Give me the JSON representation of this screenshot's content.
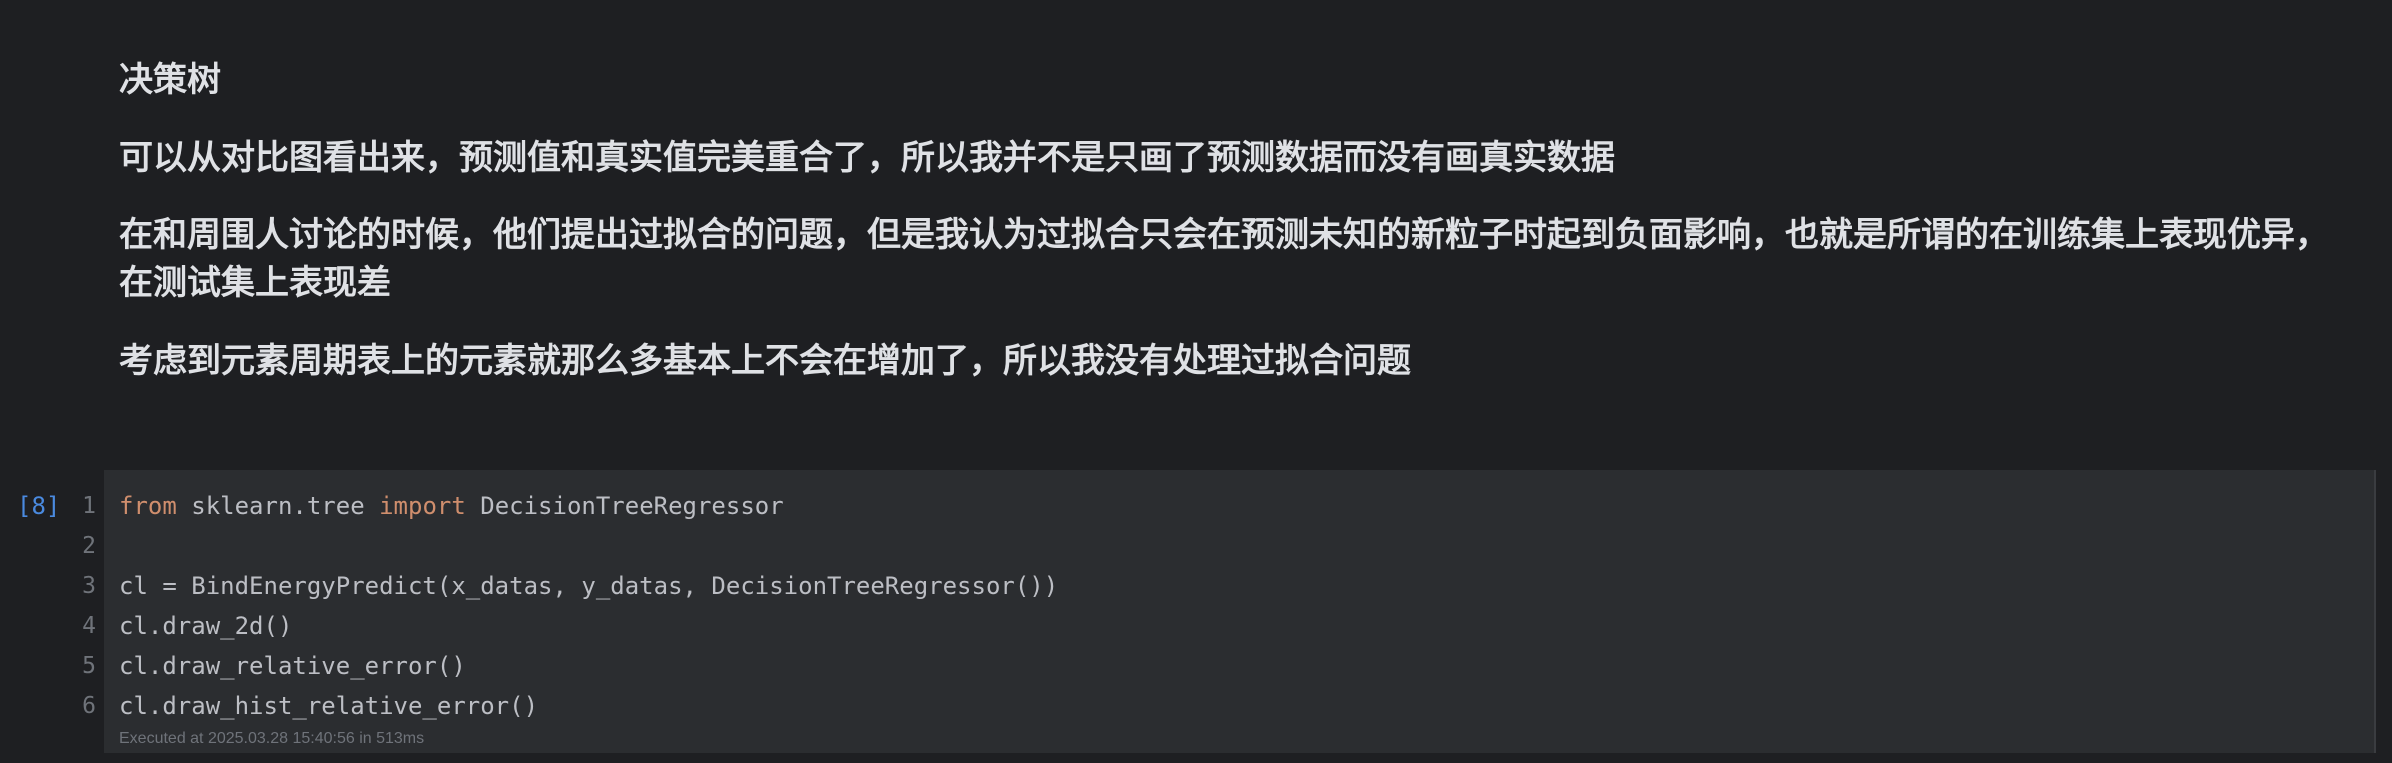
{
  "markdown": {
    "heading": "决策树",
    "para1": "可以从对比图看出来，预测值和真实值完美重合了，所以我并不是只画了预测数据而没有画真实数据",
    "para2": "在和周围人讨论的时候，他们提出过拟合的问题，但是我认为过拟合只会在预测未知的新粒子时起到负面影响，也就是所谓的在训练集上表现优异，在测试集上表现差",
    "para3": "考虑到元素周期表上的元素就那么多基本上不会在增加了，所以我没有处理过拟合问题"
  },
  "code_cell": {
    "execution_count": "[8]",
    "lines": [
      {
        "num": "1",
        "keyword1": "from",
        "mid": " sklearn.tree ",
        "keyword2": "import",
        "rest": " DecisionTreeRegressor"
      },
      {
        "num": "2",
        "text": ""
      },
      {
        "num": "3",
        "text": "cl = BindEnergyPredict(x_datas, y_datas, DecisionTreeRegressor())"
      },
      {
        "num": "4",
        "text": "cl.draw_2d()"
      },
      {
        "num": "5",
        "text": "cl.draw_relative_error()"
      },
      {
        "num": "6",
        "text": "cl.draw_hist_relative_error()"
      }
    ],
    "status": "Executed at 2025.03.28 15:40:56 in 513ms"
  }
}
